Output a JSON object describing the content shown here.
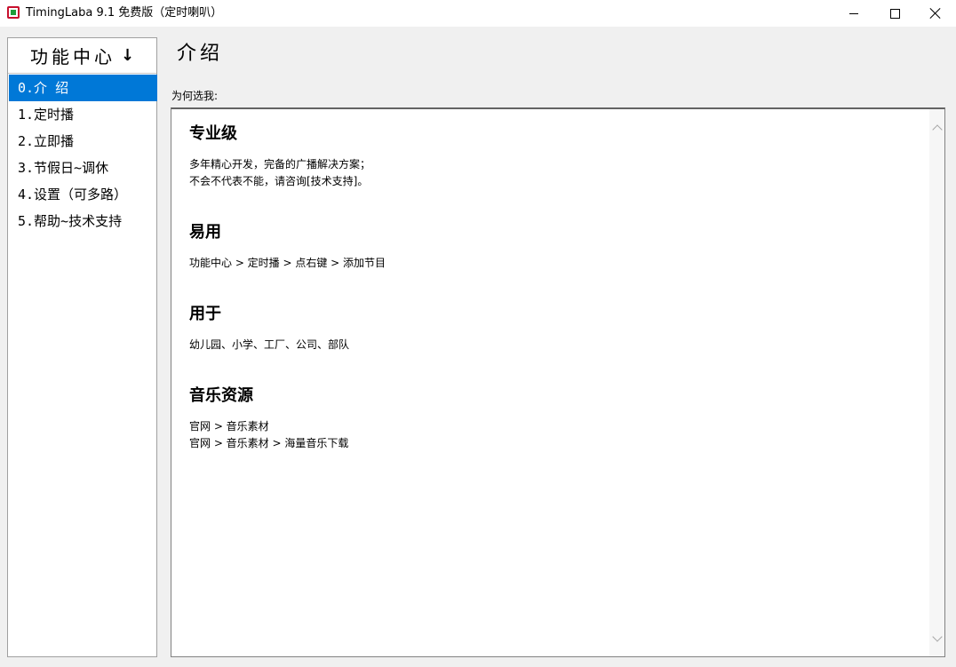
{
  "window": {
    "title": "TimingLaba 9.1 免费版（定时喇叭）",
    "minimize": "",
    "maximize": "",
    "close": ""
  },
  "sidebar": {
    "header_label": "功能中心",
    "header_arrow": "↓",
    "items": [
      {
        "label": "0.介 绍",
        "selected": true
      },
      {
        "label": "1.定时播",
        "selected": false
      },
      {
        "label": "2.立即播",
        "selected": false
      },
      {
        "label": "3.节假日~调休",
        "selected": false
      },
      {
        "label": "4.设置（可多路）",
        "selected": false
      },
      {
        "label": "5.帮助~技术支持",
        "selected": false
      }
    ]
  },
  "main": {
    "page_title": "介绍",
    "section_label": "为何选我:",
    "blocks": [
      {
        "heading": "专业级",
        "lines": [
          "多年精心开发，完备的广播解决方案；",
          "不会不代表不能，请咨询[技术支持]。"
        ]
      },
      {
        "heading": "易用",
        "lines": [
          "功能中心 > 定时播 > 点右键 > 添加节目"
        ]
      },
      {
        "heading": "用于",
        "lines": [
          "幼儿园、小学、工厂、公司、部队"
        ]
      },
      {
        "heading": "音乐资源",
        "lines": [
          "官网 > 音乐素材",
          "官网 > 音乐素材 > 海量音乐下载"
        ]
      }
    ]
  },
  "colors": {
    "selection": "#0078d7",
    "window_bg": "#f0f0f0",
    "panel_bg": "#ffffff"
  }
}
